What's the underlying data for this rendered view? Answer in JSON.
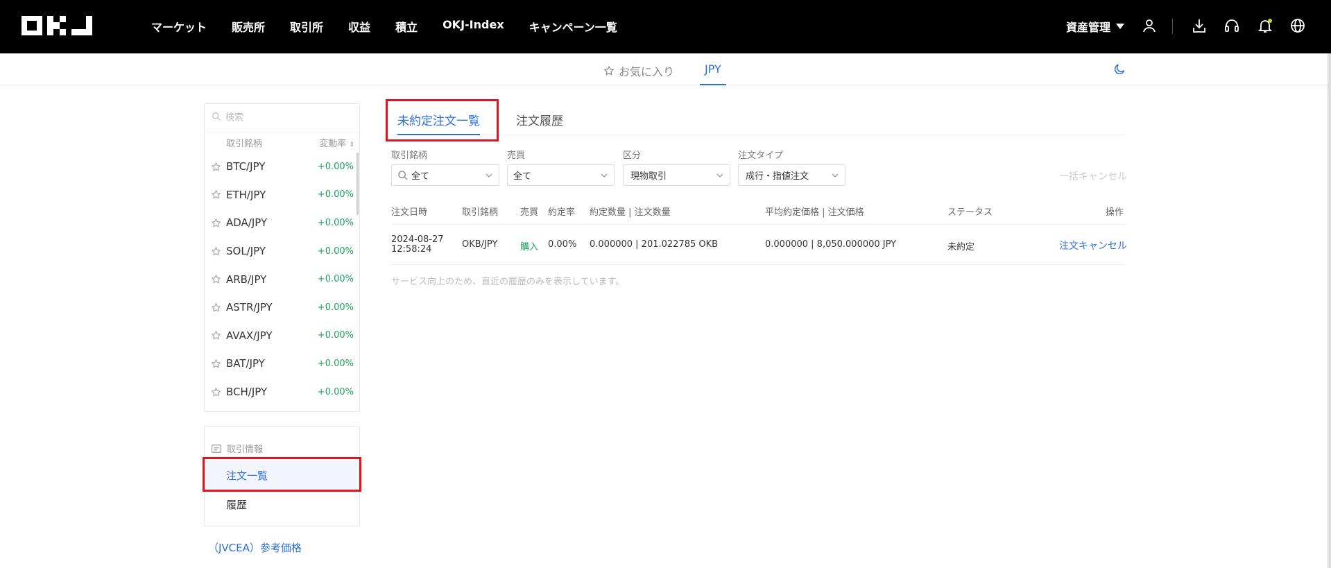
{
  "header": {
    "logo": "OKJ",
    "nav": [
      "マーケット",
      "販売所",
      "取引所",
      "収益",
      "積立",
      "OKJ-Index",
      "キャンペーン一覧"
    ],
    "asset_menu": "資産管理",
    "icons": [
      "user-icon",
      "download-icon",
      "support-icon",
      "bell-icon",
      "globe-icon"
    ]
  },
  "subnav": {
    "favorites": "お気に入り",
    "active_market": "JPY"
  },
  "market_list": {
    "search_placeholder": "検索",
    "col_pair": "取引銘柄",
    "col_change": "変動率",
    "pairs": [
      {
        "name": "BTC/JPY",
        "change": "+0.00%"
      },
      {
        "name": "ETH/JPY",
        "change": "+0.00%"
      },
      {
        "name": "ADA/JPY",
        "change": "+0.00%"
      },
      {
        "name": "SOL/JPY",
        "change": "+0.00%"
      },
      {
        "name": "ARB/JPY",
        "change": "+0.00%"
      },
      {
        "name": "ASTR/JPY",
        "change": "+0.00%"
      },
      {
        "name": "AVAX/JPY",
        "change": "+0.00%"
      },
      {
        "name": "BAT/JPY",
        "change": "+0.00%"
      },
      {
        "name": "BCH/JPY",
        "change": "+0.00%"
      }
    ]
  },
  "trade_info": {
    "header": "取引情報",
    "orders": "注文一覧",
    "history": "履歴"
  },
  "reference_price": "（JVCEA）参考価格",
  "tabs": {
    "open_orders": "未約定注文一覧",
    "order_history": "注文履歴"
  },
  "filters": {
    "pair_label": "取引銘柄",
    "pair_value": "全て",
    "side_label": "売買",
    "side_value": "全て",
    "category_label": "区分",
    "category_value": "現物取引",
    "type_label": "注文タイプ",
    "type_value": "成行・指値注文",
    "bulk_cancel": "一括キャンセル"
  },
  "table": {
    "headers": {
      "date": "注文日時",
      "pair": "取引銘柄",
      "side": "売買",
      "fill_rate": "約定率",
      "qty": "約定数量 | 注文数量",
      "price": "平均約定価格 | 注文価格",
      "status": "ステータス",
      "action": "操作"
    },
    "rows": [
      {
        "date": "2024-08-27",
        "time": "12:58:24",
        "pair": "OKB/JPY",
        "side": "購入",
        "fill_rate": "0.00%",
        "qty": "0.000000 | 201.022785 OKB",
        "price": "0.000000 | 8,050.000000 JPY",
        "status": "未約定",
        "action": "注文キャンセル"
      }
    ],
    "note": "サービス向上のため、直近の履歴のみを表示しています。"
  },
  "colors": {
    "accent": "#2c6fe0",
    "positive": "#1aa35a",
    "highlight": "#e0141e"
  }
}
